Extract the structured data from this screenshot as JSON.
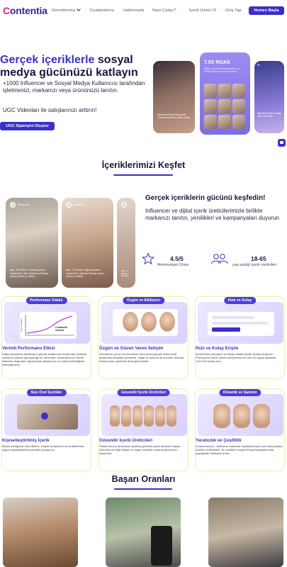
{
  "nav": {
    "logo": "Contentia",
    "items": [
      "Hizmetlerimiz",
      "Fiyatlandırma",
      "Hakkımızda",
      "Nasıl Çalışır?",
      "İçerik Üretici Ol",
      "Giriş Yap"
    ],
    "cta": "Hemen Başla"
  },
  "hero": {
    "title_highlight": "Gerçek içeriklerle",
    "title_rest_1": "sosyal",
    "title_rest_2": "medya gücünüzü katlayın",
    "desc": "+1000 Influencer ve Sosyal Medya Kullanıcısı tarafından işletmenizi, markanızı veya ürününüzü tanıtın.",
    "sub": "UGC Videoları ile satışlarınızı arttırın!",
    "cta": "UGC Siparişini Oluştur",
    "roas_title": "7.5X ROAS",
    "roas_sub": "Billion-dollar Ads performance on TikTok Ads as a new standard.",
    "card1_text": "Weekend Rush Friday with Contentia Monthly ideas ready",
    "card3_text": "Weekend Rush Friday with Contentia"
  },
  "explore": {
    "title": "İçeriklerimizi Keşfet",
    "videos": [
      {
        "name": "Efekan M.",
        "caption": "Age: 28 Worker: Domestic goods Gender/Her: Men Influencer Setting: Indoor (Home or office)"
      },
      {
        "name": "Aleda E.",
        "caption": "Age: 27 Worker: Digital products Gender/Her: Woman Setting: Indoor (Home or office)"
      },
      {
        "name": "",
        "caption": "Age: 27 Worker: Outdoor"
      }
    ],
    "headline": "Gerçek içeriklerin gücünü keşfedin!",
    "desc": "Influencer ve dijital içerik üreticilerimizle birlikte markanızı tanıtın, yenilikleri ve kampanyaları duyurun",
    "stats": [
      {
        "value": "4.5/5",
        "label": "Memnuniyet Oranı"
      },
      {
        "value": "18-65",
        "label": "yaş aralığı içerik üreticileri"
      }
    ]
  },
  "features": [
    {
      "pill": "Performans Odaklı",
      "title": "Verimli Performans Etkisi",
      "text": "Dijital pazarlama tüketicilerin gerçek kullanıcılar tarafından üretilmiş içeriklere yüksek ilgi duyduğu bir dönemde, reklamlarınızın hedef kitlenizle doğrudan bağ kurarak satışlarınızı ve marka bilinirliğinizi arttırabilirsiniz.",
      "chart_label": "Contentia seninle",
      "chart_ylabel": "Satış / Etkileşim"
    },
    {
      "pill": "Özgün ve Etkileyici",
      "title": "Özgün ve Güven Veren İletişim",
      "text": "Ürününüzü ya da bir hizmetinizi sizin adına gerçek kullanıcılar tarafından anlatılan içeriklerle, doğal bir anlatım ile sunulan videolar kullanıcıların gözünde daha güvenilirdir."
    },
    {
      "pill": "Hızlı ve Kolay",
      "title": "Hızlı ve Kolay Erişim",
      "text": "İçeriklerinizi planlayın ve birkaç dakika içinde sipariş oluşturun. Profesyonel içerik üretim süreçlerimiz ile hızlı ve uygun fiyatlarla UGC'lere sahip olun."
    },
    {
      "pill": "Size Özel İçerikler",
      "title": "Kişiselleştirilmiş İçerik",
      "text": "Marka kimliğinize özel dilinize, sosyal medyanıza ve hedeflerinize uygun kişiselleştirilmiş içerikler sunuyoruz."
    },
    {
      "pill": "Güvenilir İçerik Üreticileri",
      "title": "Güvenilir İçerik Üreticileri",
      "text": "Platformumuz tarafından seçilmiş güvenilir içerik üreticileri çalışır. Ürününüz ile ilgili detaylı ve özgün içerikler sunarak güveninizi kazanırlar."
    },
    {
      "pill": "Dinamik ve Samimi",
      "title": "Yaratıcılık ve Çeşitlilik",
      "text": "Kullanıcılarınız, markanızı hakkında duyduklarından çok daha yaratıcı içerikler üretebilirler. Bu içerikleri sosyal medya hesaplarınızda paylaşarak etkileşimi artırın."
    }
  ],
  "success": {
    "title": "Başarı Oranları"
  },
  "colors": {
    "primary": "#3b2fc9",
    "accent": "#e0237a",
    "text": "#1b1440"
  }
}
